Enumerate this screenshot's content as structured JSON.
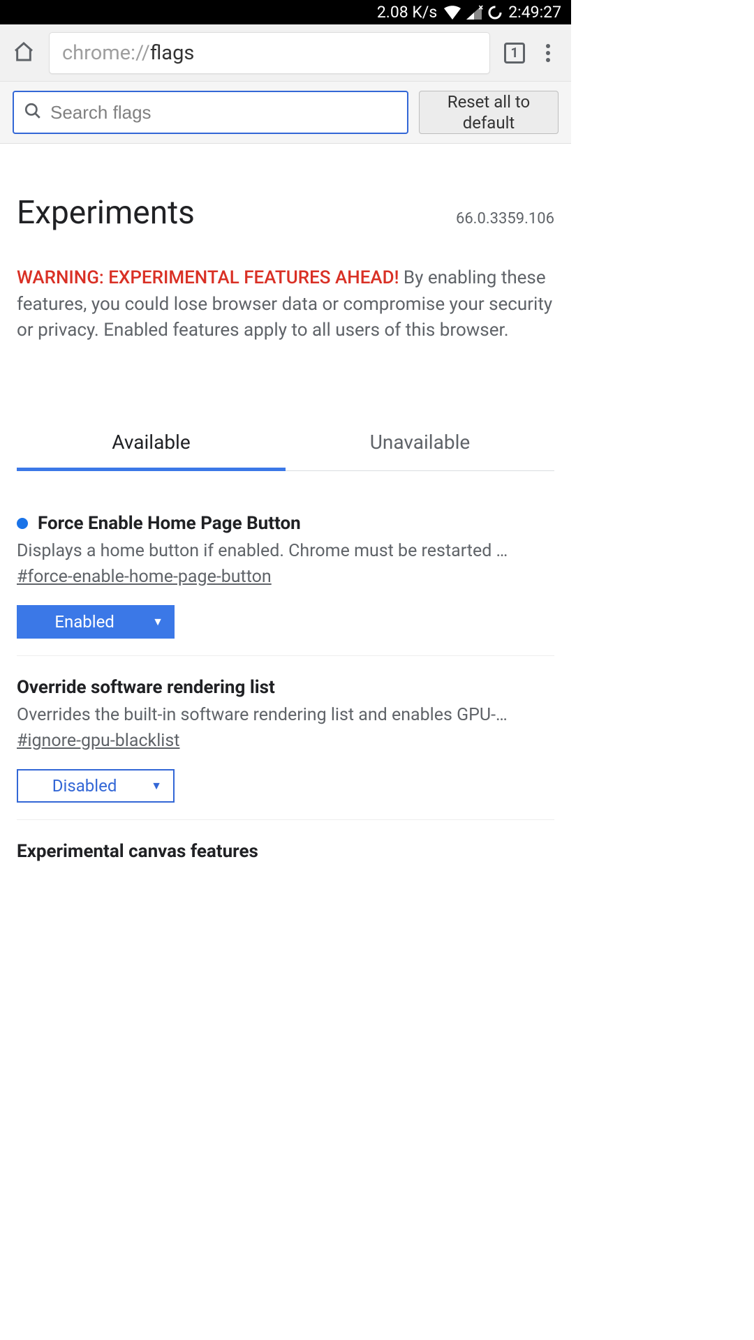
{
  "status_bar": {
    "net_speed": "2.08 K/s",
    "time": "2:49:27"
  },
  "chrome_bar": {
    "url_scheme": "chrome://",
    "url_path": "flags",
    "tab_count": "1"
  },
  "flags_controls": {
    "search_placeholder": "Search flags",
    "reset_label": "Reset all to default"
  },
  "header": {
    "title": "Experiments",
    "version": "66.0.3359.106",
    "warning_prefix": "WARNING: EXPERIMENTAL FEATURES AHEAD!",
    "warning_body": " By enabling these features, you could lose browser data or compromise your security or privacy. Enabled features apply to all users of this browser."
  },
  "tabs": {
    "available": "Available",
    "unavailable": "Unavailable"
  },
  "flags": [
    {
      "modified": true,
      "title": "Force Enable Home Page Button",
      "desc": "Displays a home button if enabled. Chrome must be restarted …",
      "anchor": "#force-enable-home-page-button",
      "value": "Enabled",
      "state": "enabled"
    },
    {
      "modified": false,
      "title": "Override software rendering list",
      "desc": "Overrides the built-in software rendering list and enables GPU-…",
      "anchor": "#ignore-gpu-blacklist",
      "value": "Disabled",
      "state": "disabled"
    },
    {
      "modified": false,
      "title": "Experimental canvas features"
    }
  ]
}
